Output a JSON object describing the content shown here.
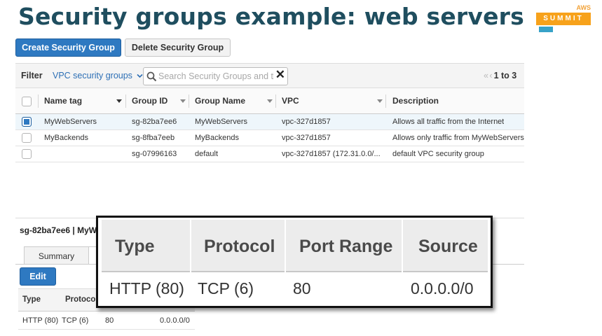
{
  "slide": {
    "title": "Security groups example: web servers"
  },
  "logo": {
    "small": "AWS",
    "main": "SUMMIT"
  },
  "toolbar": {
    "create_label": "Create Security Group",
    "delete_label": "Delete Security Group"
  },
  "filter": {
    "label": "Filter",
    "dropdown": "VPC security groups",
    "search_placeholder": "Search Security Groups and th",
    "pager": {
      "arrows": "« ‹",
      "text": "1 to 3"
    }
  },
  "table": {
    "columns": [
      "Name tag",
      "Group ID",
      "Group Name",
      "VPC",
      "Description"
    ],
    "rows": [
      {
        "selected": true,
        "name_tag": "MyWebServers",
        "group_id": "sg-82ba7ee6",
        "group_name": "MyWebServers",
        "vpc": "vpc-327d1857",
        "description": "Allows all traffic from the Internet"
      },
      {
        "selected": false,
        "name_tag": "MyBackends",
        "group_id": "sg-8fba7eeb",
        "group_name": "MyBackends",
        "vpc": "vpc-327d1857",
        "description": "Allows only traffic from MyWebServers"
      },
      {
        "selected": false,
        "name_tag": "",
        "group_id": "sg-07996163",
        "group_name": "default",
        "vpc": "vpc-327d1857 (172.31.0.0/...",
        "description": "default VPC security group"
      }
    ]
  },
  "details": {
    "title": "sg-82ba7ee6 | MyW",
    "tab_summary": "Summary",
    "edit_label": "Edit",
    "rules_columns": [
      "Type",
      "Protocol"
    ],
    "rule": {
      "type": "HTTP (80)",
      "protocol": "TCP (6)",
      "port": "80",
      "source": "0.0.0.0/0"
    }
  },
  "zoom": {
    "columns": [
      "Type",
      "Protocol",
      "Port Range",
      "Source"
    ],
    "row": {
      "type": "HTTP (80)",
      "protocol": "TCP (6)",
      "port": "80",
      "source": "0.0.0.0/0"
    }
  },
  "colors": {
    "title": "#1f4e5f",
    "primary_button": "#2e79c1",
    "link": "#2d6fb5",
    "logo": "#f7a21b"
  }
}
